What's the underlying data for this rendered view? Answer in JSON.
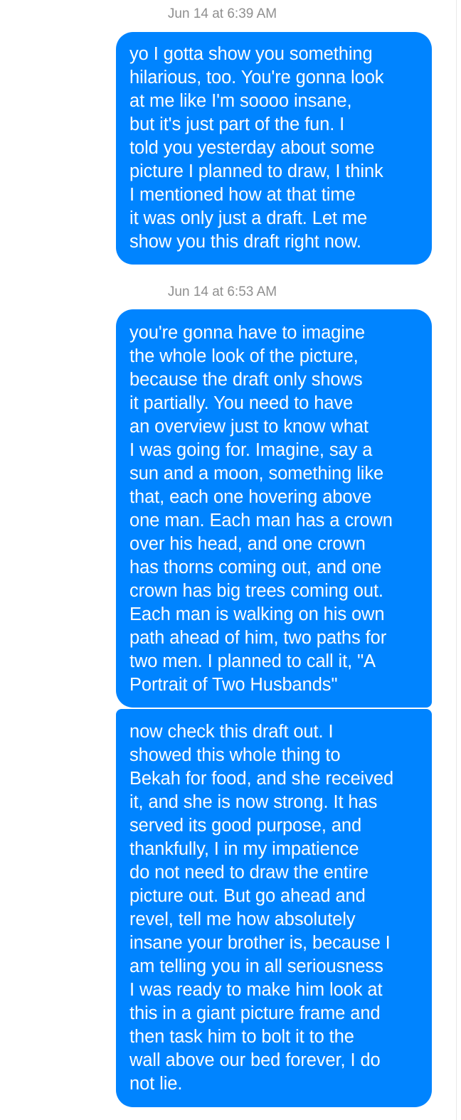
{
  "conversation": {
    "groups": [
      {
        "timestamp": "Jun 14 at 6:39 AM",
        "messages": [
          {
            "text": "yo I gotta show you something\nhilarious, too. You're gonna look\nat me like I'm soooo insane,\nbut it's just part of the fun. I\ntold you yesterday about some\npicture I planned to draw, I think\nI mentioned how at that time\nit was only just a draft. Let me\nshow you this draft right now."
          }
        ]
      },
      {
        "timestamp": "Jun 14 at 6:53 AM",
        "messages": [
          {
            "text": "you're gonna have to imagine\nthe whole look of the picture,\nbecause the draft only shows\nit partially. You need to have\nan overview just to know what\nI was going for. Imagine, say a\nsun and a moon, something like\nthat, each one hovering above\none man. Each man has a crown\nover his head, and one crown\nhas thorns coming out, and one\ncrown has big trees coming out.\nEach man is walking on his own\npath ahead of him, two paths for\ntwo men. I planned to call it, \"A\nPortrait of Two Husbands\""
          },
          {
            "text": "now check this draft out. I\nshowed this whole thing to\nBekah for food, and she received\nit, and she is now strong. It has\nserved its good purpose, and\nthankfully, I in my impatience\ndo not need to draw the entire\npicture out. But go ahead and\nrevel, tell me how absolutely\ninsane your brother is, because I\nam telling you in all seriousness\nI was ready to make him look at\nthis in a giant picture frame and\nthen task him to bolt it to the\nwall above our bed forever, I do\nnot lie."
          }
        ]
      }
    ]
  },
  "colors": {
    "bubble_background": "#0084ff",
    "bubble_text": "#ffffff",
    "timestamp_text": "#8f8f8f",
    "page_background": "#ffffff"
  }
}
